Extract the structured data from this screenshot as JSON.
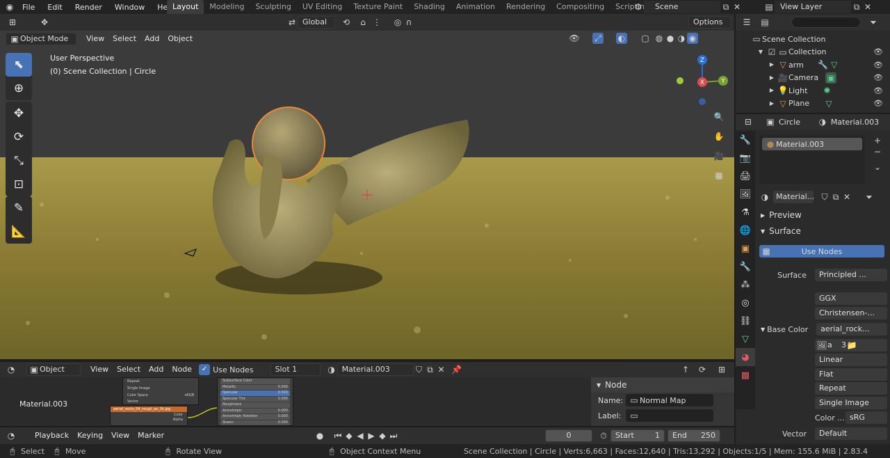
{
  "topbar": {
    "menus": [
      "File",
      "Edit",
      "Render",
      "Window",
      "Help"
    ],
    "workspaces": [
      "Layout",
      "Modeling",
      "Sculpting",
      "UV Editing",
      "Texture Paint",
      "Shading",
      "Animation",
      "Rendering",
      "Compositing",
      "Scripting"
    ],
    "add_workspace": "+",
    "scene": "Scene",
    "view_layer": "View Layer"
  },
  "viewport_header": {
    "mode": "Object Mode",
    "menus": [
      "View",
      "Select",
      "Add",
      "Object"
    ],
    "orientation": "Global",
    "options": "Options"
  },
  "viewport": {
    "perspective": "User Perspective",
    "collection": "(0) Scene Collection | Circle",
    "gizmo": {
      "z": "Z",
      "y": "Y",
      "x": "X"
    }
  },
  "outliner": {
    "search_placeholder": "",
    "root": "Scene Collection",
    "collection": "Collection",
    "items": [
      {
        "name": "arm"
      },
      {
        "name": "Camera"
      },
      {
        "name": "Light"
      },
      {
        "name": "Plane"
      }
    ]
  },
  "properties": {
    "object": "Circle",
    "material_header": "Material.003",
    "slot": "Material.003",
    "material_name": "Material...",
    "preview": "Preview",
    "surface_panel": "Surface",
    "use_nodes": "Use Nodes",
    "surface_label": "Surface",
    "surface_value": "Principled ...",
    "distribution": "GGX",
    "subsurface": "Christensen-...",
    "base_color_label": "Base Color",
    "base_color_value": "aerial_rock...",
    "image_name": "a",
    "image_users": "3",
    "interpolation": "Linear",
    "projection": "Flat",
    "extension": "Repeat",
    "source": "Single Image",
    "color_label": "Color ...",
    "color_space": "sRG",
    "vector_label": "Vector",
    "vector_value": "Default"
  },
  "node_editor": {
    "type": "Object",
    "menus": [
      "View",
      "Select",
      "Add",
      "Node"
    ],
    "use_nodes": "Use Nodes",
    "slot": "Slot 1",
    "material": "Material.003",
    "canvas_label": "Material.003",
    "panel_title": "Node",
    "name_label": "Name:",
    "name_value": "Normal Map",
    "label_label": "Label:",
    "label_value": "",
    "node_texture_title": "aerial_rocks_04_rough_ao_2k.jpg",
    "node_rows": [
      "Repeat",
      "Single Image",
      "Color Space",
      "Vector"
    ],
    "node_colorspace": "sRGB",
    "node_color": "Color",
    "node_alpha": "Alpha",
    "bsdf_rows": [
      {
        "label": "Subsurface Color",
        "value": ""
      },
      {
        "label": "Metallic",
        "value": "0.000"
      },
      {
        "label": "Specular",
        "value": "0.500"
      },
      {
        "label": "Specular Tint",
        "value": "0.000"
      },
      {
        "label": "Roughness",
        "value": ""
      },
      {
        "label": "Anisotropic",
        "value": "0.000"
      },
      {
        "label": "Anisotropic Rotation",
        "value": "0.000"
      },
      {
        "label": "Sheen",
        "value": "0.000"
      }
    ]
  },
  "timeline": {
    "menus": [
      "Playback",
      "Keying",
      "View",
      "Marker"
    ],
    "current_frame": "0",
    "start_label": "Start",
    "start": "1",
    "end_label": "End",
    "end": "250"
  },
  "statusbar": {
    "select": "Select",
    "move": "Move",
    "rotate_view": "Rotate View",
    "context_menu": "Object Context Menu",
    "stats": "Scene Collection | Circle | Verts:6,663 | Faces:12,640 | Tris:13,292 | Objects:1/5 | Mem: 155.6 MiB | 2.83.4"
  },
  "colors": {
    "accent_blue": "#4772b3",
    "selection_orange": "#e88a3a",
    "ground": "#8a7a36"
  }
}
